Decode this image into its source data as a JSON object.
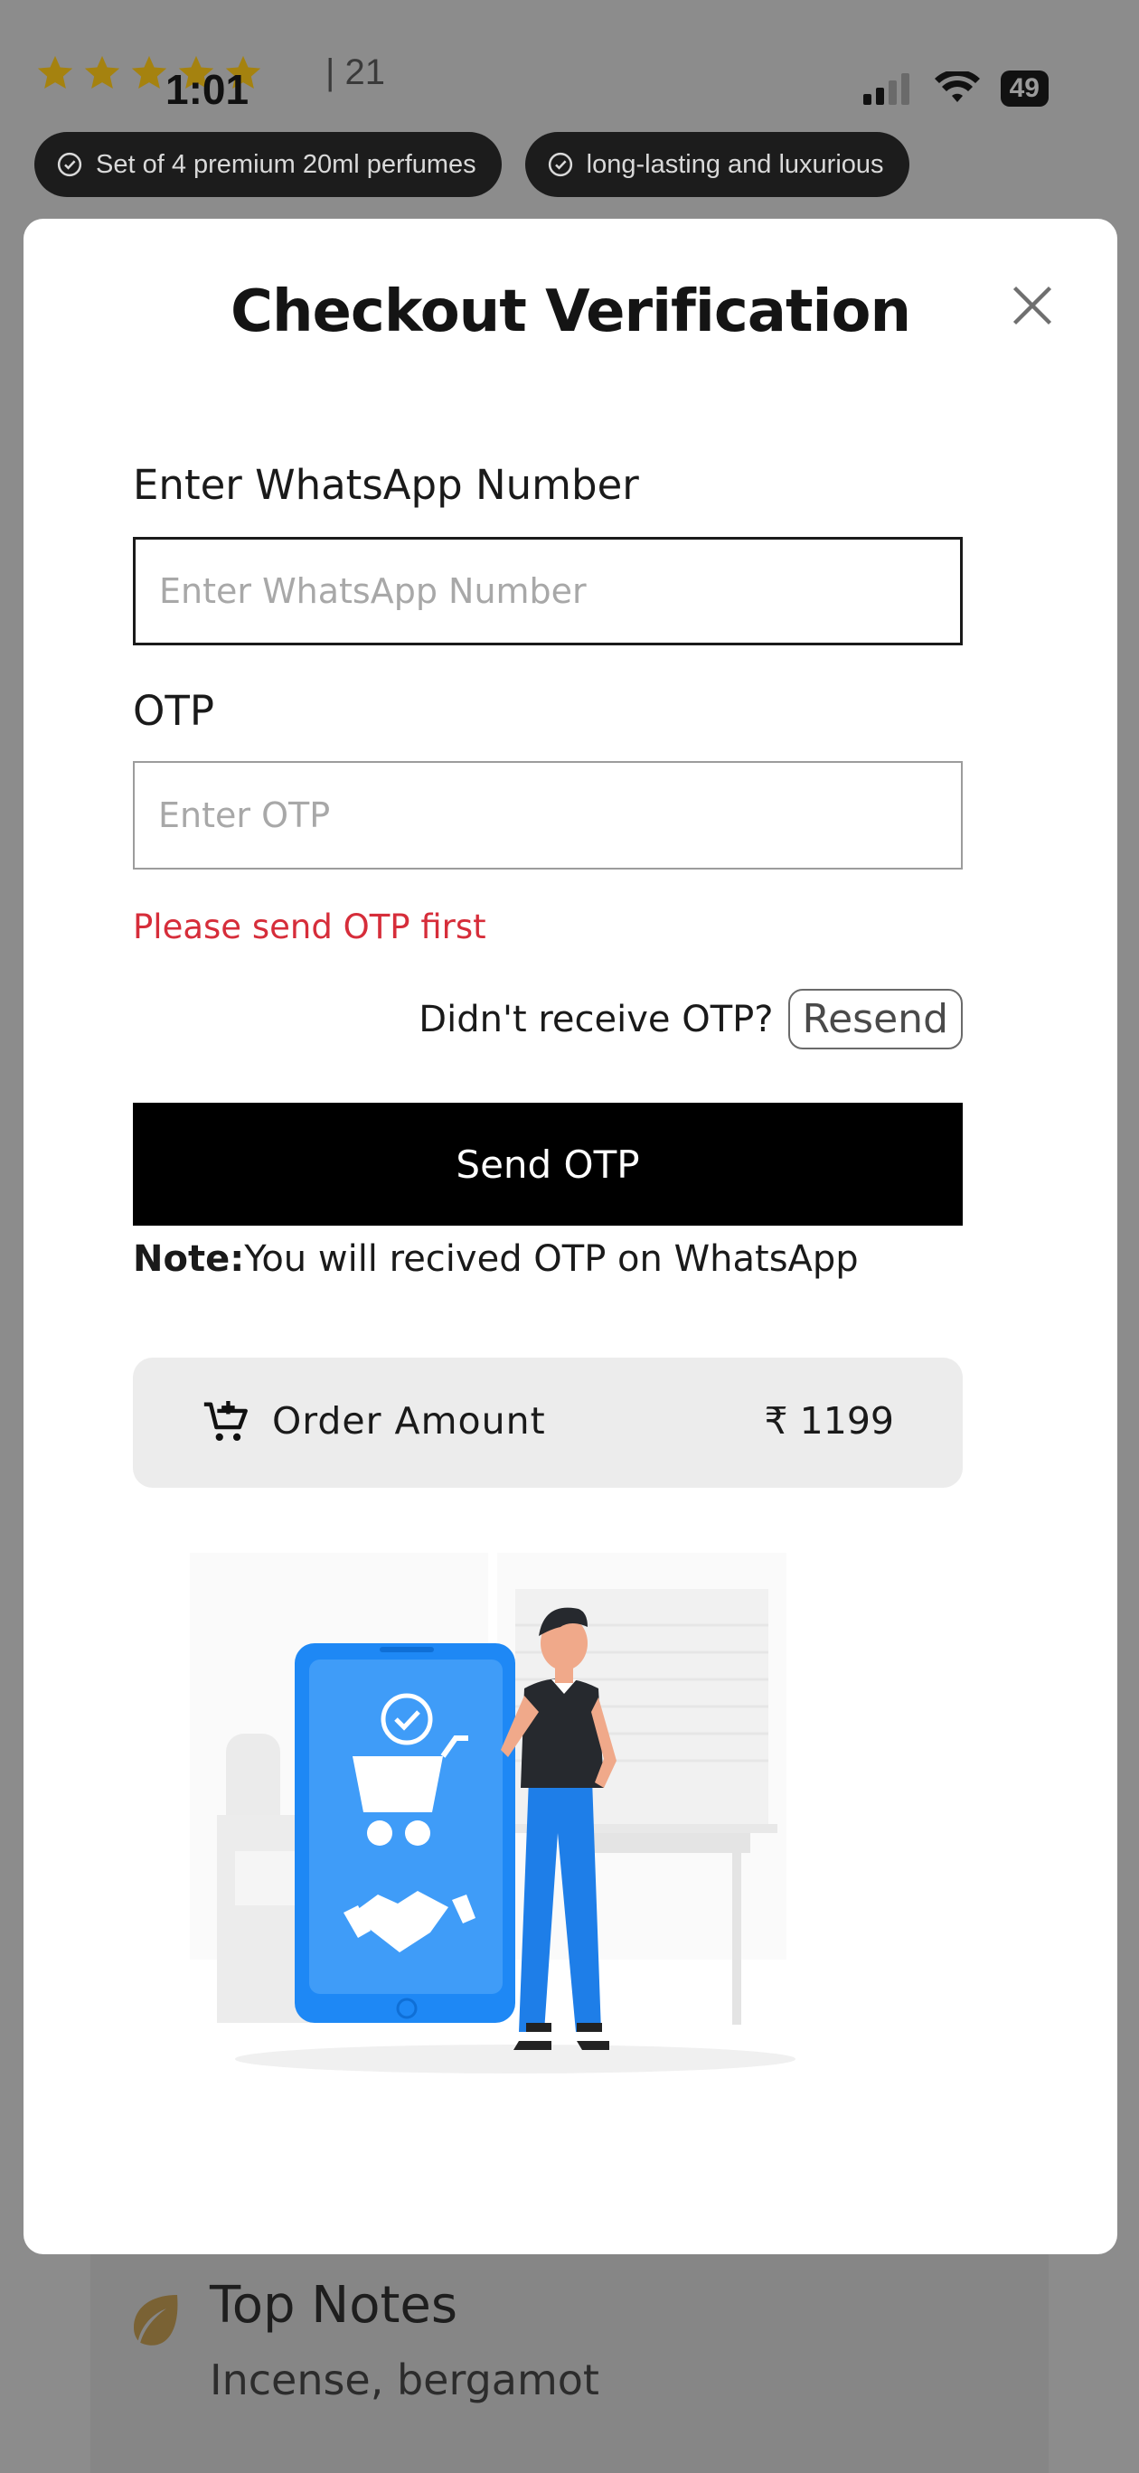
{
  "status_bar": {
    "time": "1:01",
    "battery": "49"
  },
  "product": {
    "rating_stars": 5,
    "review_count": "| 21",
    "chips": [
      {
        "label": "Set of 4 premium 20ml perfumes",
        "icon": "check-circle-icon"
      },
      {
        "label": "long-lasting and luxurious",
        "icon": "check-circle-icon"
      }
    ],
    "notes": {
      "title": "Top Notes",
      "text": "Incense, bergamot"
    }
  },
  "modal": {
    "title": "Checkout Verification",
    "whatsapp": {
      "label": "Enter WhatsApp Number",
      "placeholder": "Enter WhatsApp Number",
      "value": ""
    },
    "otp": {
      "label": "OTP",
      "placeholder": "Enter OTP",
      "value": ""
    },
    "error": "Please send OTP first",
    "resend_question": "Didn't receive OTP?",
    "resend_label": "Resend",
    "send_label": "Send OTP",
    "note_bold": "Note:",
    "note_text": "You will recived OTP on WhatsApp",
    "order_amount_label": "Order Amount",
    "order_amount_value": "₹ 1199"
  },
  "colors": {
    "accent_blue": "#1e88f5",
    "error_red": "#d62d3a",
    "star_gold": "#b08a10"
  }
}
